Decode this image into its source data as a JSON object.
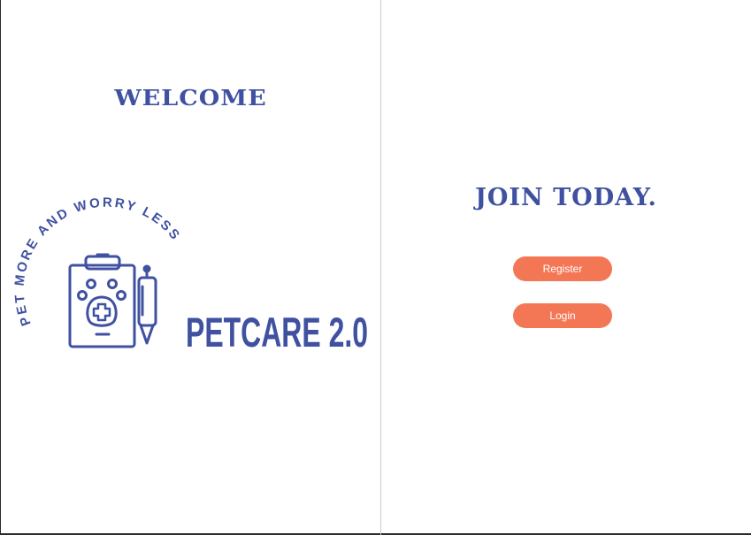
{
  "left": {
    "heading": "WELCOME",
    "logo": {
      "tagline": "PET MORE AND WORRY LESS",
      "brand": "PETCARE 2.0",
      "icon": "clipboard-paw-pen-icon",
      "color": "#3f51a0"
    }
  },
  "right": {
    "heading": "JOIN TODAY.",
    "register_label": "Register",
    "login_label": "Login",
    "button_color": "#f47755"
  }
}
